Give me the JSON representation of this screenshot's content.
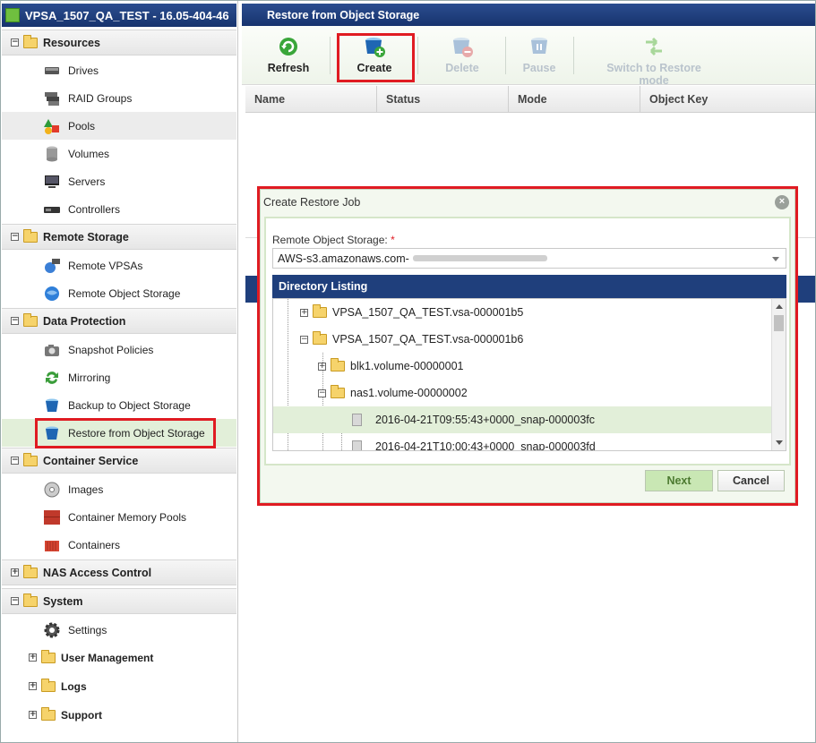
{
  "app": {
    "title": "VPSA_1507_QA_TEST - 16.05-404-46"
  },
  "sidebar": {
    "categories": {
      "resources": "Resources",
      "remote_storage": "Remote Storage",
      "data_protection": "Data Protection",
      "container_service": "Container Service",
      "nas_access_control": "NAS Access Control",
      "system": "System"
    },
    "items": {
      "drives": "Drives",
      "raid_groups": "RAID Groups",
      "pools": "Pools",
      "volumes": "Volumes",
      "servers": "Servers",
      "controllers": "Controllers",
      "remote_vpsas": "Remote VPSAs",
      "remote_object_storage": "Remote Object Storage",
      "snapshot_policies": "Snapshot Policies",
      "mirroring": "Mirroring",
      "backup_to_object_storage": "Backup to Object Storage",
      "restore_from_object_storage": "Restore from Object Storage",
      "images": "Images",
      "container_memory_pools": "Container Memory Pools",
      "containers": "Containers",
      "settings": "Settings",
      "user_management": "User Management",
      "logs": "Logs",
      "support": "Support"
    }
  },
  "main": {
    "title": "Restore from Object Storage",
    "toolbar": {
      "refresh": "Refresh",
      "create": "Create",
      "delete": "Delete",
      "pause": "Pause",
      "switch": "Switch to Restore mode"
    },
    "columns": [
      "Name",
      "Status",
      "Mode",
      "Object Key"
    ]
  },
  "dialog": {
    "title": "Create Restore Job",
    "close_symbol": "×",
    "field_label": "Remote Object Storage:",
    "required_mark": "*",
    "field_value": "AWS-s3.amazonaws.com-",
    "directory_title": "Directory Listing",
    "tree": [
      {
        "label": "VPSA_1507_QA_TEST.vsa-000001b5",
        "expander": "+"
      },
      {
        "label": "VPSA_1507_QA_TEST.vsa-000001b6",
        "expander": "−"
      },
      {
        "label": "blk1.volume-00000001",
        "expander": "+"
      },
      {
        "label": "nas1.volume-00000002",
        "expander": "−"
      },
      {
        "label": "2016-04-21T09:55:43+0000_snap-000003fc"
      },
      {
        "label": "2016-04-21T10:00:43+0000_snap-000003fd"
      }
    ],
    "next": "Next",
    "cancel": "Cancel"
  },
  "colors": {
    "header_blue": "#1f3f7c",
    "highlight_red": "#e01b22",
    "selection_green": "#e2efd9",
    "next_button": "#c9e7b4"
  }
}
